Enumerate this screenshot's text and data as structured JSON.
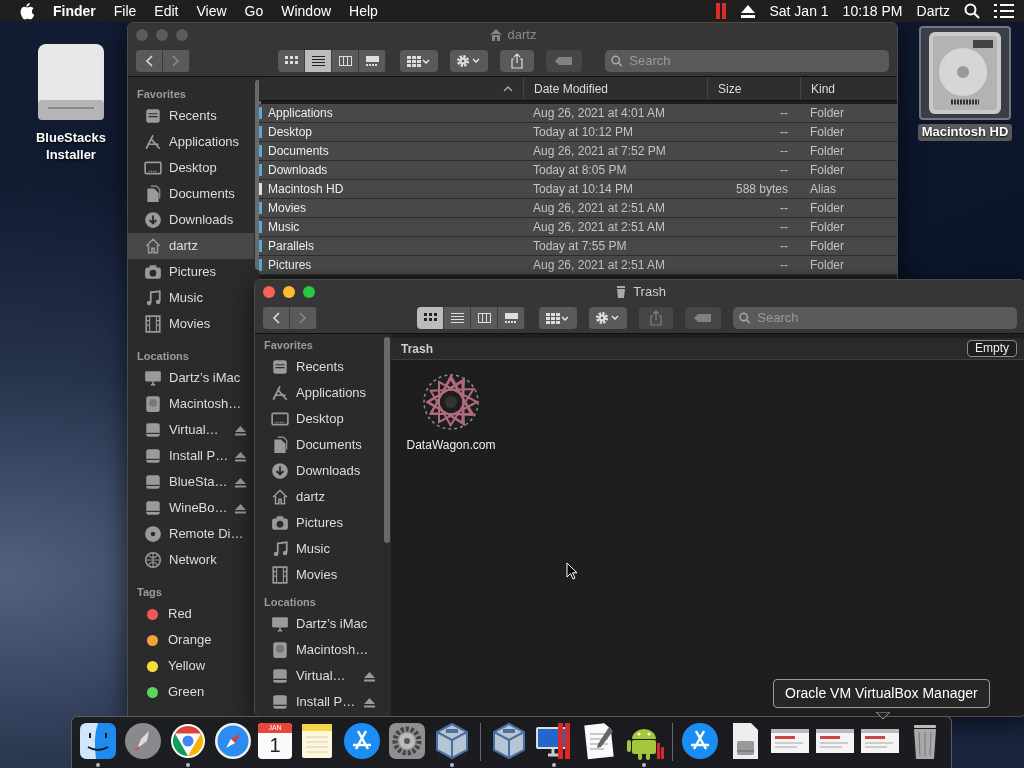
{
  "menu_bar": {
    "app": "Finder",
    "menus": [
      "File",
      "Edit",
      "View",
      "Go",
      "Window",
      "Help"
    ],
    "date": "Sat Jan 1",
    "time": "10:18 PM",
    "user": "Dartz"
  },
  "desktop_icons": [
    {
      "kind": "removable",
      "label": "BlueStacks Installer",
      "selected": false
    },
    {
      "kind": "hard_disk",
      "label": "Macintosh HD",
      "selected": true
    }
  ],
  "windows": [
    {
      "kind": "home",
      "title": "dartz",
      "active": false,
      "views": [
        {
          "kind": "icons",
          "selected": false
        },
        {
          "kind": "list",
          "selected": true
        },
        {
          "kind": "columns",
          "selected": false
        },
        {
          "kind": "gallery",
          "selected": false
        }
      ],
      "actions": [
        {
          "kind": "arrange",
          "disabled": false
        },
        {
          "kind": "gear",
          "disabled": false
        },
        {
          "kind": "share",
          "disabled": false
        },
        {
          "kind": "tag",
          "disabled": true
        }
      ],
      "search": {
        "placeholder": "Search"
      },
      "sidebar": [
        {
          "heading": "Favorites",
          "items": [
            {
              "label": "Recents",
              "kind": "recents",
              "selected": false
            },
            {
              "label": "Applications",
              "kind": "applications",
              "selected": false
            },
            {
              "label": "Desktop",
              "kind": "desktop",
              "selected": false
            },
            {
              "label": "Documents",
              "kind": "documents",
              "selected": false
            },
            {
              "label": "Downloads",
              "kind": "downloads",
              "selected": false
            },
            {
              "label": "dartz",
              "kind": "home",
              "selected": true
            },
            {
              "label": "Pictures",
              "kind": "pictures",
              "selected": false
            },
            {
              "label": "Music",
              "kind": "music",
              "selected": false
            },
            {
              "label": "Movies",
              "kind": "movies",
              "selected": false
            }
          ]
        },
        {
          "heading": "Locations",
          "items": [
            {
              "label": "Dartz’s iMac",
              "kind": "computer",
              "selected": false
            },
            {
              "label": "Macintosh…",
              "kind": "hard_disk",
              "selected": false
            },
            {
              "label": "Virtual…",
              "kind": "drive",
              "selected": false,
              "eject": true
            },
            {
              "label": "Install P…",
              "kind": "drive",
              "selected": false,
              "eject": true
            },
            {
              "label": "BlueSta…",
              "kind": "drive",
              "selected": false,
              "eject": true
            },
            {
              "label": "WineBo…",
              "kind": "drive",
              "selected": false,
              "eject": true
            },
            {
              "label": "Remote Di…",
              "kind": "disc",
              "selected": false
            },
            {
              "label": "Network",
              "kind": "network",
              "selected": false
            }
          ]
        },
        {
          "heading": "Tags",
          "items": [
            {
              "label": "Red",
              "kind": "tag",
              "color": "#ee5a5a",
              "selected": false
            },
            {
              "label": "Orange",
              "kind": "tag",
              "color": "#f2a23a",
              "selected": false
            },
            {
              "label": "Yellow",
              "kind": "tag",
              "color": "#f2df3a",
              "selected": false
            },
            {
              "label": "Green",
              "kind": "tag",
              "color": "#5bd45e",
              "selected": false
            }
          ]
        }
      ],
      "content": {
        "kind": "list",
        "columns": [
          "Date Modified",
          "Size",
          "Kind"
        ],
        "rows": [
          {
            "kind": "folder",
            "name": "Applications",
            "date_modified": "Aug 26, 2021 at 4:01 AM",
            "size": "--",
            "type": "Folder",
            "selected": true
          },
          {
            "kind": "folder",
            "name": "Desktop",
            "date_modified": "Today at 10:12 PM",
            "size": "--",
            "type": "Folder",
            "selected": true
          },
          {
            "kind": "folder",
            "name": "Documents",
            "date_modified": "Aug 26, 2021 at 7:52 PM",
            "size": "--",
            "type": "Folder",
            "selected": true
          },
          {
            "kind": "folder",
            "name": "Downloads",
            "date_modified": "Today at 8:05 PM",
            "size": "--",
            "type": "Folder",
            "selected": true
          },
          {
            "kind": "alias",
            "name": "Macintosh HD",
            "date_modified": "Today at 10:14 PM",
            "size": "588 bytes",
            "type": "Alias",
            "selected": true
          },
          {
            "kind": "folder",
            "name": "Movies",
            "date_modified": "Aug 26, 2021 at 2:51 AM",
            "size": "--",
            "type": "Folder",
            "selected": true
          },
          {
            "kind": "folder",
            "name": "Music",
            "date_modified": "Aug 26, 2021 at 2:51 AM",
            "size": "--",
            "type": "Folder",
            "selected": true
          },
          {
            "kind": "folder",
            "name": "Parallels",
            "date_modified": "Today at 7:55 PM",
            "size": "--",
            "type": "Folder",
            "selected": true
          },
          {
            "kind": "folder",
            "name": "Pictures",
            "date_modified": "Aug 26, 2021 at 2:51 AM",
            "size": "--",
            "type": "Folder",
            "selected": true
          }
        ]
      }
    },
    {
      "kind": "trash",
      "title": "Trash",
      "active": true,
      "views": [
        {
          "kind": "icons",
          "selected": true
        },
        {
          "kind": "list",
          "selected": false
        },
        {
          "kind": "columns",
          "selected": false
        },
        {
          "kind": "gallery",
          "selected": false
        }
      ],
      "actions": [
        {
          "kind": "arrange",
          "disabled": false
        },
        {
          "kind": "gear",
          "disabled": false
        },
        {
          "kind": "share",
          "disabled": true
        },
        {
          "kind": "tag",
          "disabled": true
        }
      ],
      "search": {
        "placeholder": "Search"
      },
      "sidebar": [
        {
          "heading": "Favorites",
          "items": [
            {
              "label": "Recents",
              "kind": "recents",
              "selected": false
            },
            {
              "label": "Applications",
              "kind": "applications",
              "selected": false
            },
            {
              "label": "Desktop",
              "kind": "desktop",
              "selected": false
            },
            {
              "label": "Documents",
              "kind": "documents",
              "selected": false
            },
            {
              "label": "Downloads",
              "kind": "downloads",
              "selected": false
            },
            {
              "label": "dartz",
              "kind": "home",
              "selected": false
            },
            {
              "label": "Pictures",
              "kind": "pictures",
              "selected": false
            },
            {
              "label": "Music",
              "kind": "music",
              "selected": false
            },
            {
              "label": "Movies",
              "kind": "movies",
              "selected": false
            }
          ]
        },
        {
          "heading": "Locations",
          "items": [
            {
              "label": "Dartz’s iMac",
              "kind": "computer",
              "selected": false
            },
            {
              "label": "Macintosh…",
              "kind": "hard_disk",
              "selected": false
            },
            {
              "label": "Virtual…",
              "kind": "drive",
              "selected": false,
              "eject": true
            },
            {
              "label": "Install P…",
              "kind": "drive",
              "selected": false,
              "eject": true
            }
          ]
        }
      ],
      "content": {
        "kind": "icons",
        "path": "Trash",
        "button": "Empty",
        "items": [
          {
            "label": "DataWagon.com"
          }
        ]
      }
    }
  ],
  "dock": {
    "items": [
      {
        "kind": "finder",
        "running": true
      },
      {
        "kind": "launchpad",
        "running": false
      },
      {
        "kind": "browser",
        "running": true
      },
      {
        "kind": "compass",
        "running": false
      },
      {
        "kind": "calendar",
        "month": "JAN",
        "day": "1",
        "running": false
      },
      {
        "kind": "notes",
        "running": false
      },
      {
        "kind": "app_store",
        "running": false
      },
      {
        "kind": "settings",
        "running": false
      },
      {
        "kind": "cube",
        "running": true
      },
      {
        "kind": "separator"
      },
      {
        "kind": "cube",
        "running": false
      },
      {
        "kind": "monitor",
        "running": true
      },
      {
        "kind": "document",
        "running": false
      },
      {
        "kind": "android",
        "running": true
      },
      {
        "kind": "separator"
      },
      {
        "kind": "app_store",
        "running": false
      },
      {
        "kind": "disk_image",
        "running": false
      },
      {
        "kind": "thumbnail",
        "running": false
      },
      {
        "kind": "thumbnail",
        "running": false
      },
      {
        "kind": "thumbnail",
        "running": false
      },
      {
        "kind": "trash",
        "running": false
      }
    ]
  },
  "tooltip": "Oracle VM VirtualBox Manager"
}
